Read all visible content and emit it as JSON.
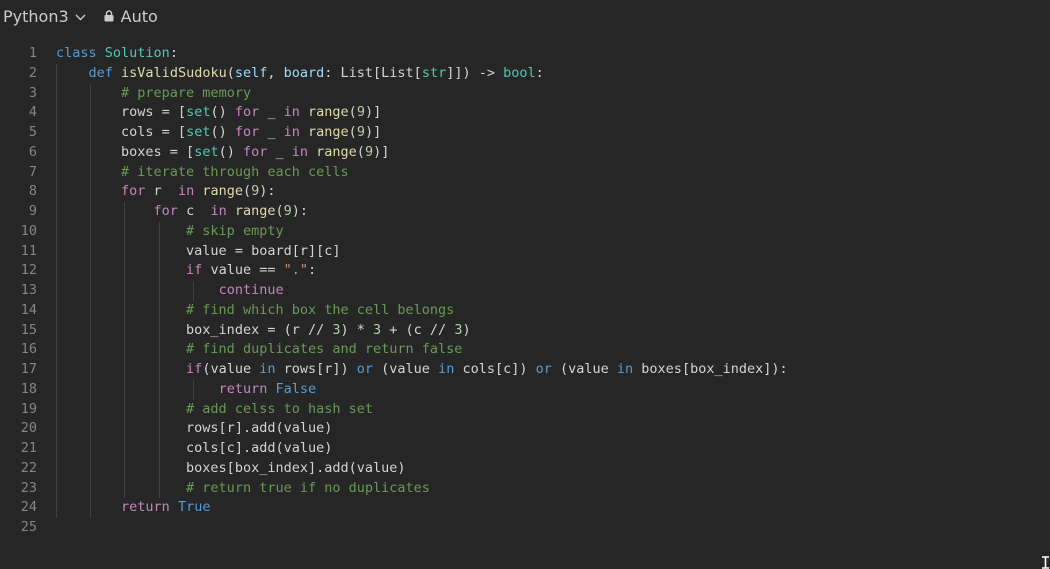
{
  "toolbar": {
    "language": "Python3",
    "language_icon": "chevron-down-icon",
    "mode": "Auto",
    "mode_icon": "lock-icon"
  },
  "editor": {
    "colors": {
      "background": "#262626",
      "keyword": "#569cd6",
      "control": "#c586c0",
      "class": "#4ec9b0",
      "function": "#dcdcaa",
      "comment": "#6a9955",
      "number": "#b5cea8",
      "string": "#ce9178"
    },
    "lines": [
      {
        "n": "1",
        "indent": 0,
        "tokens": [
          [
            "kw",
            "class"
          ],
          [
            "pl",
            " "
          ],
          [
            "cls",
            "Solution"
          ],
          [
            "pl",
            ":"
          ]
        ]
      },
      {
        "n": "2",
        "indent": 1,
        "tokens": [
          [
            "kw",
            "def"
          ],
          [
            "pl",
            " "
          ],
          [
            "fn",
            "isValidSudoku"
          ],
          [
            "pl",
            "("
          ],
          [
            "self",
            "self"
          ],
          [
            "pl",
            ", "
          ],
          [
            "var",
            "board"
          ],
          [
            "pl",
            ": List[List["
          ],
          [
            "cls",
            "str"
          ],
          [
            "pl",
            "]]) -> "
          ],
          [
            "cls",
            "bool"
          ],
          [
            "pl",
            ":"
          ]
        ]
      },
      {
        "n": "3",
        "indent": 2,
        "tokens": [
          [
            "cm",
            "# prepare memory"
          ]
        ]
      },
      {
        "n": "4",
        "indent": 2,
        "tokens": [
          [
            "pl",
            "rows = ["
          ],
          [
            "cls",
            "set"
          ],
          [
            "pl",
            "() "
          ],
          [
            "ctrl",
            "for"
          ],
          [
            "pl",
            " _ "
          ],
          [
            "ctrl",
            "in"
          ],
          [
            "pl",
            " "
          ],
          [
            "fn",
            "range"
          ],
          [
            "pl",
            "("
          ],
          [
            "num",
            "9"
          ],
          [
            "pl",
            ")]"
          ]
        ]
      },
      {
        "n": "5",
        "indent": 2,
        "tokens": [
          [
            "pl",
            "cols = ["
          ],
          [
            "cls",
            "set"
          ],
          [
            "pl",
            "() "
          ],
          [
            "ctrl",
            "for"
          ],
          [
            "pl",
            " _ "
          ],
          [
            "ctrl",
            "in"
          ],
          [
            "pl",
            " "
          ],
          [
            "fn",
            "range"
          ],
          [
            "pl",
            "("
          ],
          [
            "num",
            "9"
          ],
          [
            "pl",
            ")]"
          ]
        ]
      },
      {
        "n": "6",
        "indent": 2,
        "tokens": [
          [
            "pl",
            "boxes = ["
          ],
          [
            "cls",
            "set"
          ],
          [
            "pl",
            "() "
          ],
          [
            "ctrl",
            "for"
          ],
          [
            "pl",
            " _ "
          ],
          [
            "ctrl",
            "in"
          ],
          [
            "pl",
            " "
          ],
          [
            "fn",
            "range"
          ],
          [
            "pl",
            "("
          ],
          [
            "num",
            "9"
          ],
          [
            "pl",
            ")]"
          ]
        ]
      },
      {
        "n": "7",
        "indent": 2,
        "tokens": [
          [
            "cm",
            "# iterate through each cells"
          ]
        ]
      },
      {
        "n": "8",
        "indent": 2,
        "tokens": [
          [
            "ctrl",
            "for"
          ],
          [
            "pl",
            " r  "
          ],
          [
            "ctrl",
            "in"
          ],
          [
            "pl",
            " "
          ],
          [
            "fn",
            "range"
          ],
          [
            "pl",
            "("
          ],
          [
            "num",
            "9"
          ],
          [
            "pl",
            "):"
          ]
        ]
      },
      {
        "n": "9",
        "indent": 3,
        "tokens": [
          [
            "ctrl",
            "for"
          ],
          [
            "pl",
            " c  "
          ],
          [
            "ctrl",
            "in"
          ],
          [
            "pl",
            " "
          ],
          [
            "fn",
            "range"
          ],
          [
            "pl",
            "("
          ],
          [
            "num",
            "9"
          ],
          [
            "pl",
            "):"
          ]
        ]
      },
      {
        "n": "10",
        "indent": 4,
        "tokens": [
          [
            "cm",
            "# skip empty"
          ]
        ]
      },
      {
        "n": "11",
        "indent": 4,
        "tokens": [
          [
            "pl",
            "value = board[r][c]"
          ]
        ]
      },
      {
        "n": "12",
        "indent": 4,
        "tokens": [
          [
            "ctrl",
            "if"
          ],
          [
            "pl",
            " value == "
          ],
          [
            "str",
            "\".\""
          ],
          [
            "pl",
            ":"
          ]
        ]
      },
      {
        "n": "13",
        "indent": 5,
        "tokens": [
          [
            "ctrl",
            "continue"
          ]
        ]
      },
      {
        "n": "14",
        "indent": 4,
        "tokens": [
          [
            "cm",
            "# find which box the cell belongs"
          ]
        ]
      },
      {
        "n": "15",
        "indent": 4,
        "tokens": [
          [
            "pl",
            "box_index = (r // "
          ],
          [
            "num",
            "3"
          ],
          [
            "pl",
            ") * "
          ],
          [
            "num",
            "3"
          ],
          [
            "pl",
            " + (c // "
          ],
          [
            "num",
            "3"
          ],
          [
            "pl",
            ")"
          ]
        ]
      },
      {
        "n": "16",
        "indent": 4,
        "tokens": [
          [
            "cm",
            "# find duplicates and return false"
          ]
        ]
      },
      {
        "n": "17",
        "indent": 4,
        "tokens": [
          [
            "ctrl",
            "if"
          ],
          [
            "pl",
            "(value "
          ],
          [
            "kw",
            "in"
          ],
          [
            "pl",
            " rows[r]) "
          ],
          [
            "kw",
            "or"
          ],
          [
            "pl",
            " (value "
          ],
          [
            "kw",
            "in"
          ],
          [
            "pl",
            " cols[c]) "
          ],
          [
            "kw",
            "or"
          ],
          [
            "pl",
            " (value "
          ],
          [
            "kw",
            "in"
          ],
          [
            "pl",
            " boxes[box_index]):"
          ]
        ]
      },
      {
        "n": "18",
        "indent": 5,
        "tokens": [
          [
            "ctrl",
            "return"
          ],
          [
            "pl",
            " "
          ],
          [
            "kw",
            "False"
          ]
        ]
      },
      {
        "n": "19",
        "indent": 4,
        "tokens": [
          [
            "cm",
            "# add celss to hash set"
          ]
        ]
      },
      {
        "n": "20",
        "indent": 4,
        "tokens": [
          [
            "pl",
            "rows[r].add(value)"
          ]
        ]
      },
      {
        "n": "21",
        "indent": 4,
        "tokens": [
          [
            "pl",
            "cols[c].add(value)"
          ]
        ]
      },
      {
        "n": "22",
        "indent": 4,
        "tokens": [
          [
            "pl",
            "boxes[box_index].add(value)"
          ]
        ]
      },
      {
        "n": "23",
        "indent": 4,
        "tokens": [
          [
            "cm",
            "# return true if no duplicates"
          ]
        ]
      },
      {
        "n": "24",
        "indent": 2,
        "tokens": [
          [
            "ctrl",
            "return"
          ],
          [
            "pl",
            " "
          ],
          [
            "kw",
            "True"
          ]
        ]
      },
      {
        "n": "25",
        "indent": 0,
        "tokens": []
      }
    ]
  }
}
